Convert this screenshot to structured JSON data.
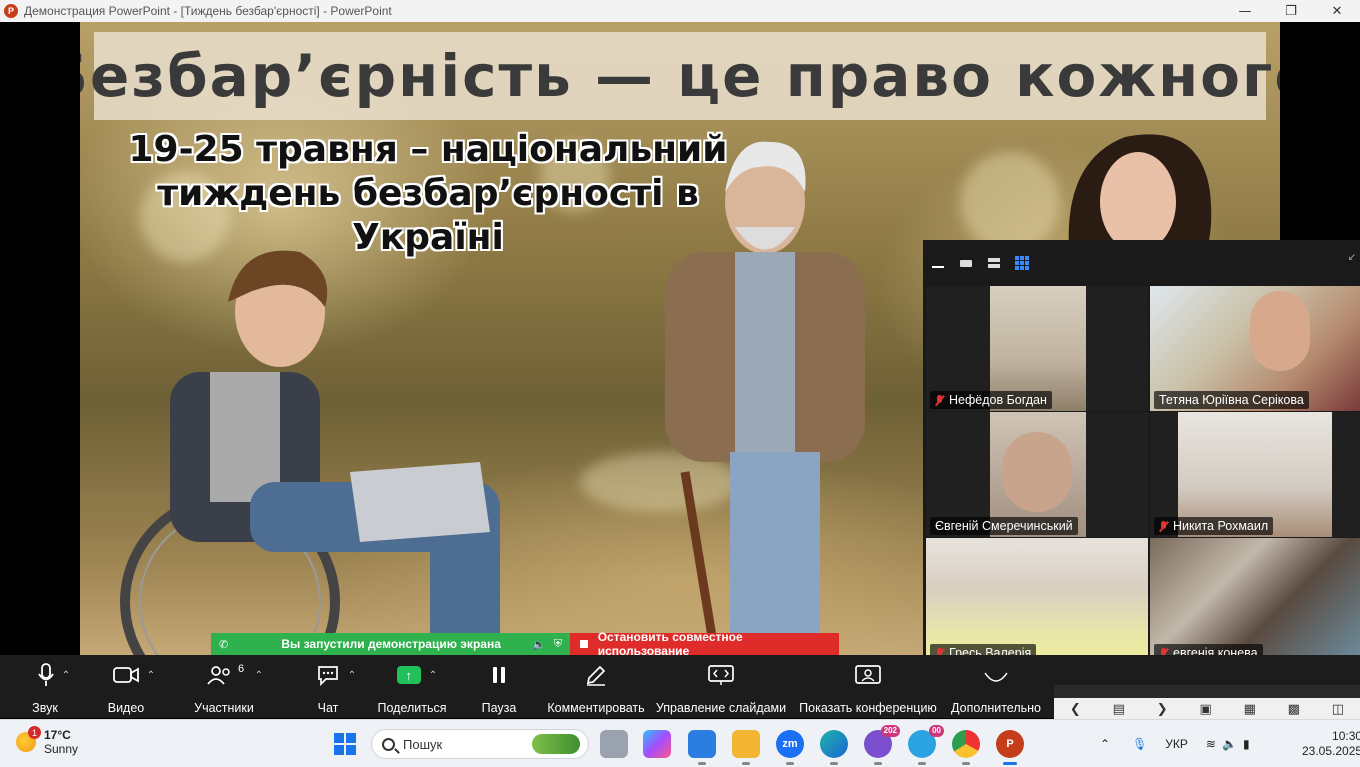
{
  "window": {
    "app_icon": "powerpoint-icon",
    "title": "Демонстрация PowerPoint - [Тиждень безбар'єрності] - PowerPoint",
    "controls": [
      "minimize",
      "restore",
      "close"
    ]
  },
  "slide": {
    "title": "Безбар’єрність — це право кожного",
    "subtitle": "19-25 травня – національний тиждень безбар’єрності в Україні"
  },
  "share_notice": {
    "status": "Вы запустили демонстрацию экрана",
    "stop": "Остановить совместное использование"
  },
  "gallery": {
    "tiles": [
      {
        "name": "Нефёдов Богдан",
        "muted": true
      },
      {
        "name": "Тетяна Юріївна Серікова",
        "muted": false,
        "active": true
      },
      {
        "name": "Євгеній Смеречинський",
        "muted": false
      },
      {
        "name": "Никита Рохмаил",
        "muted": true
      },
      {
        "name": "Гресь Валерія",
        "muted": true
      },
      {
        "name": "евгенія  конева",
        "muted": true
      }
    ]
  },
  "toolbar": {
    "audio": "Звук",
    "video": "Видео",
    "participants": "Участники",
    "participants_count": "6",
    "chat": "Чат",
    "share": "Поделиться",
    "pause": "Пауза",
    "annotate": "Комментировать",
    "slides": "Управление слайдами",
    "show_meeting": "Показать конференцию",
    "more": "Дополнительно"
  },
  "taskbar": {
    "weather_temp": "17°C",
    "weather_cond": "Sunny",
    "weather_badge": "1",
    "search_placeholder": "Пошук",
    "viber_badge": "202",
    "telegram_badge": "00",
    "language": "УКР",
    "time": "10:30",
    "date": "23.05.2025"
  },
  "colors": {
    "share_green": "#2fb14e",
    "stop_red": "#e02b2b",
    "active_speaker": "#29c46a",
    "muted_mic": "#e23434"
  }
}
